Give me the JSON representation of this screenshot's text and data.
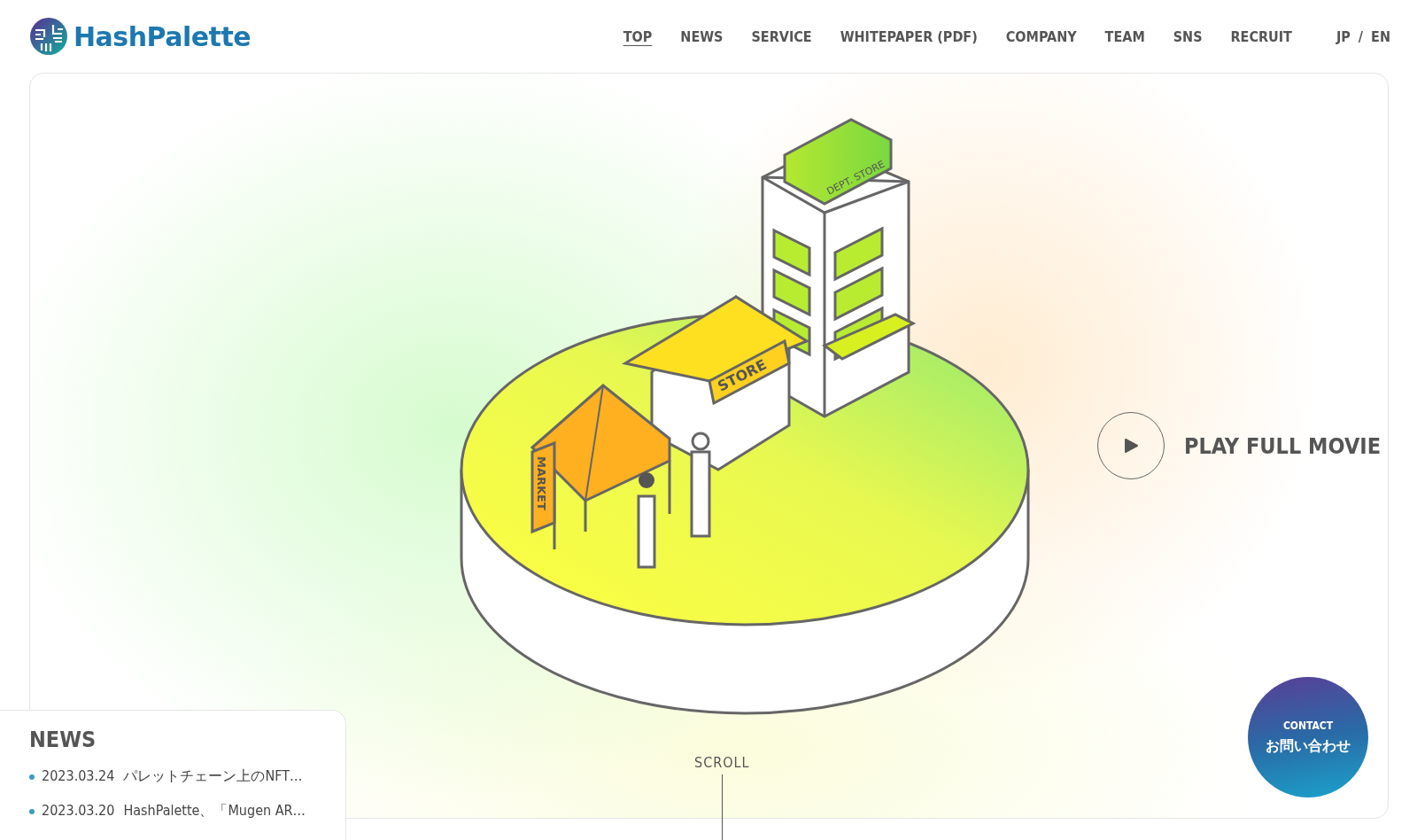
{
  "header": {
    "logo_text": "HashPalette",
    "nav": [
      {
        "label": "TOP",
        "selected": true
      },
      {
        "label": "NEWS",
        "selected": false
      },
      {
        "label": "SERVICE",
        "selected": false
      },
      {
        "label": "WHITEPAPER (PDF)",
        "selected": false
      },
      {
        "label": "COMPANY",
        "selected": false
      },
      {
        "label": "TEAM",
        "selected": false
      },
      {
        "label": "SNS",
        "selected": false
      },
      {
        "label": "RECRUIT",
        "selected": false
      }
    ],
    "languages": [
      "JP",
      "EN"
    ],
    "language_separator": "/"
  },
  "hero": {
    "illustration_labels": {
      "dept_store": "DEPT. STORE",
      "store": "STORE",
      "market": "MARKET"
    },
    "play_label": "PLAY FULL MOVIE",
    "scroll_label": "SCROLL"
  },
  "news": {
    "title": "NEWS",
    "items": [
      {
        "date": "2023.03.24",
        "title": "パレットチェーン上のNFT…"
      },
      {
        "date": "2023.03.20",
        "title": "HashPalette、「Mugen AR…"
      }
    ]
  },
  "contact": {
    "label_en": "CONTACT",
    "label_jp": "お問い合わせ"
  }
}
